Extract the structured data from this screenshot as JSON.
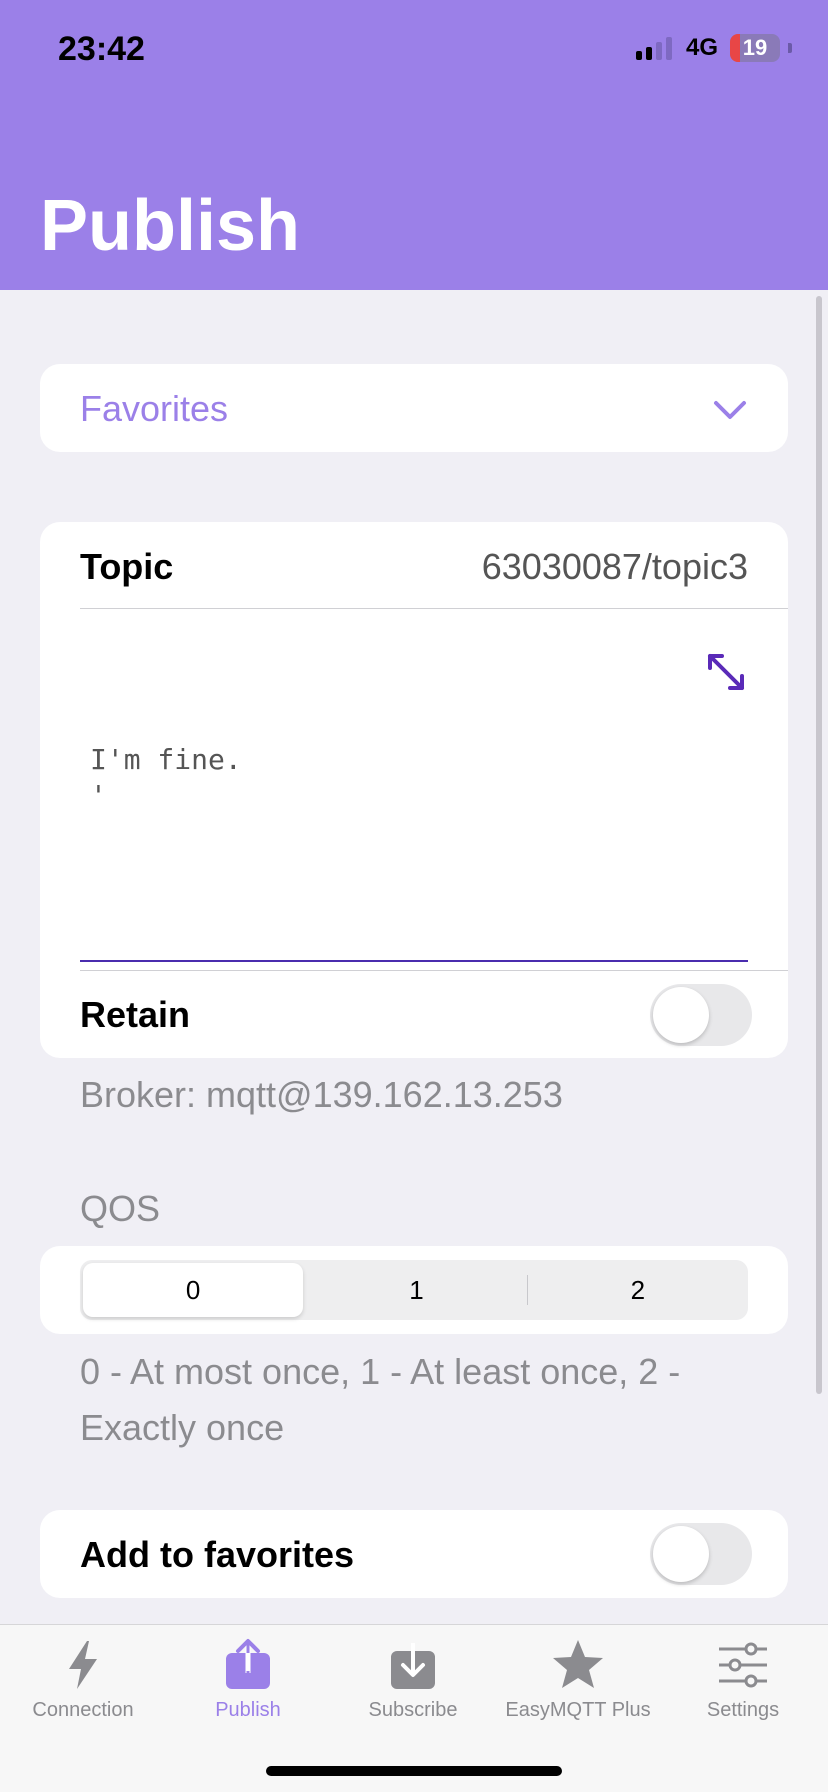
{
  "status_bar": {
    "time": "23:42",
    "network": "4G",
    "battery": "19",
    "battery_level": 0.19
  },
  "header": {
    "title": "Publish",
    "background": "#9b80e8"
  },
  "favorites": {
    "label": "Favorites"
  },
  "topic": {
    "label": "Topic",
    "value": "63030087/topic3"
  },
  "payload": {
    "text": "I'm fine.\n'"
  },
  "retain": {
    "label": "Retain",
    "on": false
  },
  "broker": {
    "text": "Broker: mqtt@139.162.13.253"
  },
  "qos": {
    "title": "QOS",
    "options": [
      "0",
      "1",
      "2"
    ],
    "selected": "0",
    "description": "0 - At most once, 1 - At least once, 2 - Exactly once"
  },
  "add_to_favorites": {
    "label": "Add to favorites",
    "on": false
  },
  "tabs": [
    {
      "label": "Connection",
      "icon": "bolt-icon",
      "active": false
    },
    {
      "label": "Publish",
      "icon": "upload-icon",
      "active": true
    },
    {
      "label": "Subscribe",
      "icon": "download-icon",
      "active": false
    },
    {
      "label": "EasyMQTT Plus",
      "icon": "star-icon",
      "active": false
    },
    {
      "label": "Settings",
      "icon": "sliders-icon",
      "active": false
    }
  ],
  "colors": {
    "accent": "#9b80e8",
    "inactive": "#8b8b8f",
    "input_underline": "#4a2cae"
  }
}
